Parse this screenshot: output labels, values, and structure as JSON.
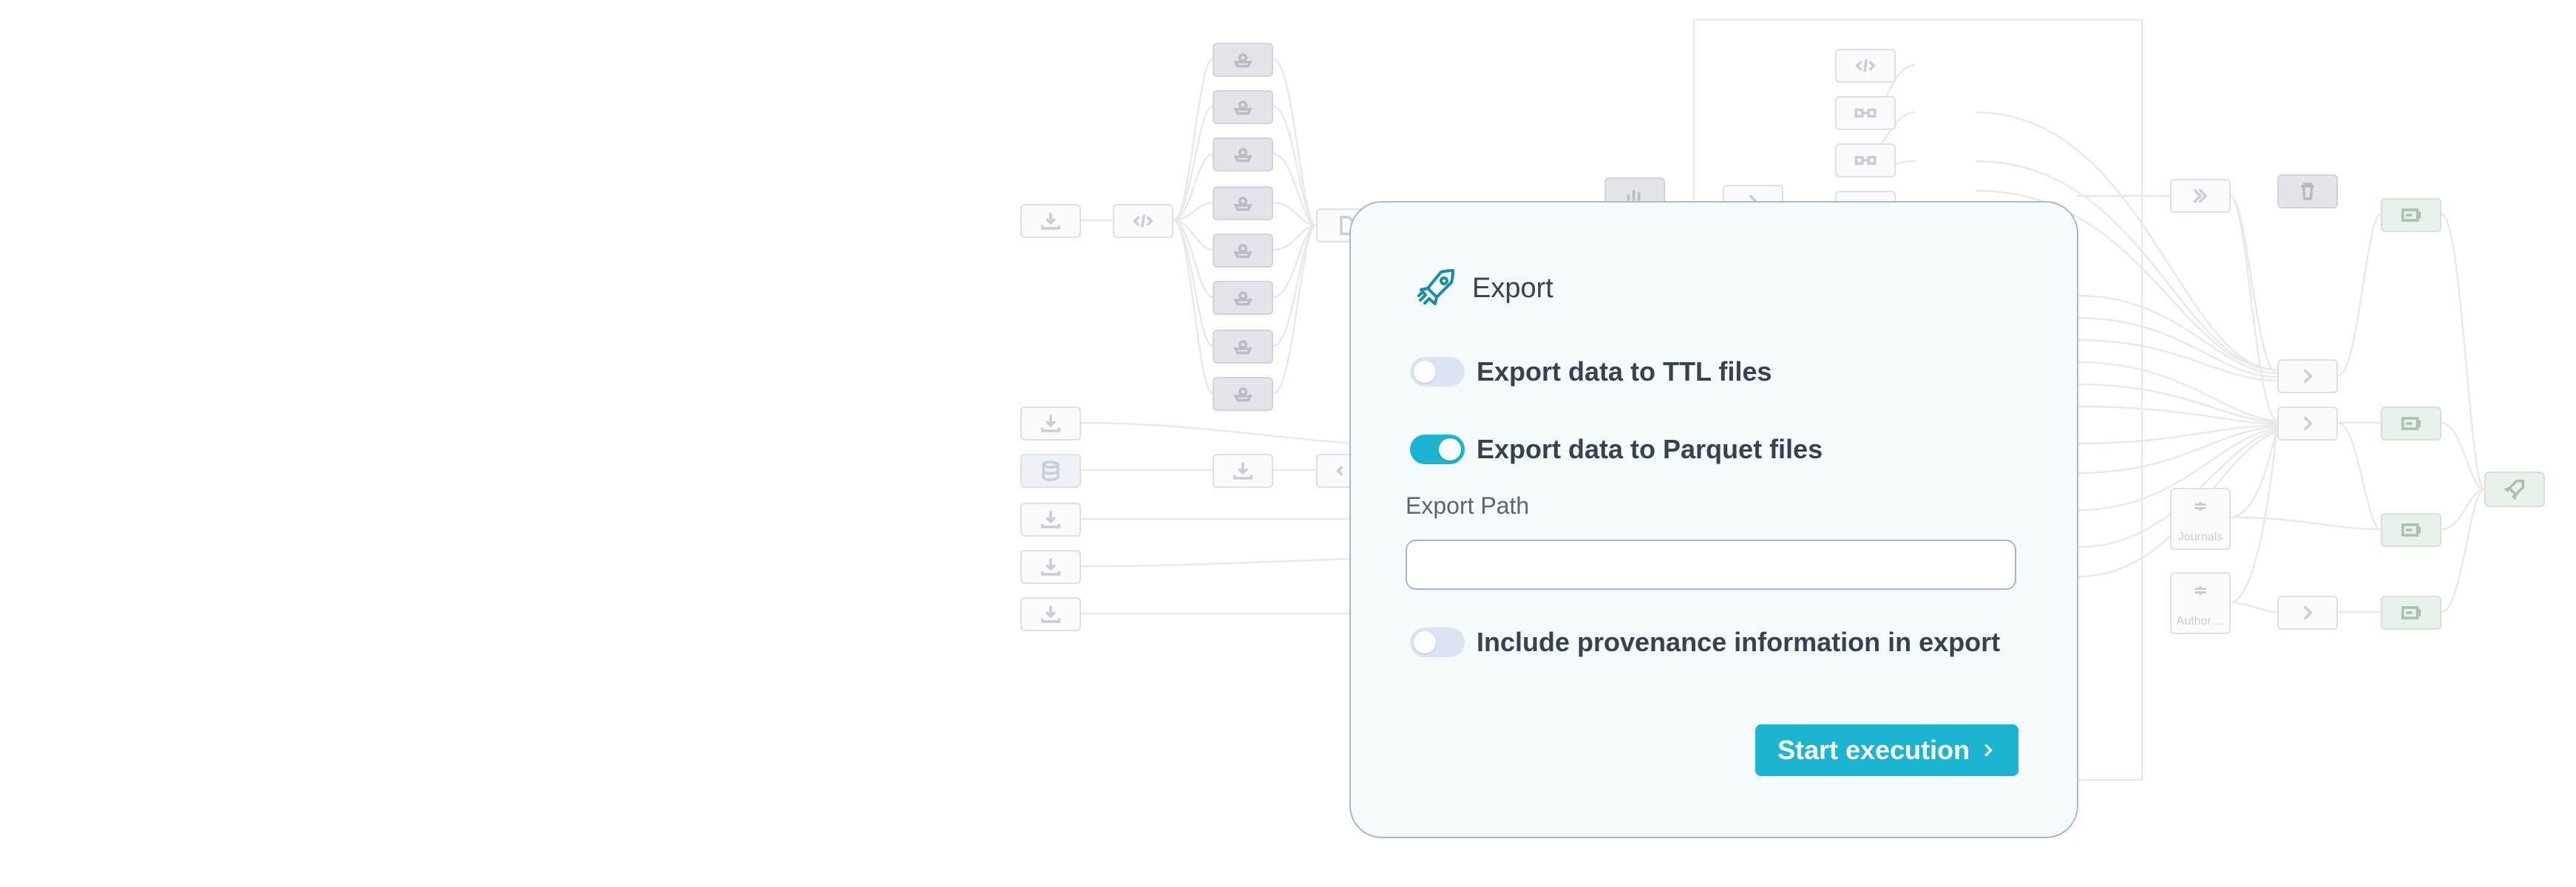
{
  "modal": {
    "title": "Export",
    "options": [
      {
        "label": "Export data to TTL files",
        "on": false
      },
      {
        "label": "Export data to Parquet files",
        "on": true
      },
      {
        "label": "Include provenance information in export",
        "on": false
      }
    ],
    "path_label": "Export Path",
    "path_value": "",
    "path_placeholder": "",
    "start_label": "Start execution"
  },
  "graph": {
    "captions": {
      "journals": "Journals",
      "author": "Author ..."
    }
  },
  "colors": {
    "accent": "#1bb5d1",
    "text": "#364152",
    "modal_bg": "#f5fafd",
    "modal_border": "#a8b8cf",
    "toggle_off": "#dbe4f3"
  },
  "icons": [
    "rocket-icon",
    "download-icon",
    "code-icon",
    "puzzle-icon",
    "database-icon",
    "chevron-right-icon",
    "link-icon",
    "server-icon",
    "trash-icon",
    "chart-icon",
    "document-icon"
  ]
}
